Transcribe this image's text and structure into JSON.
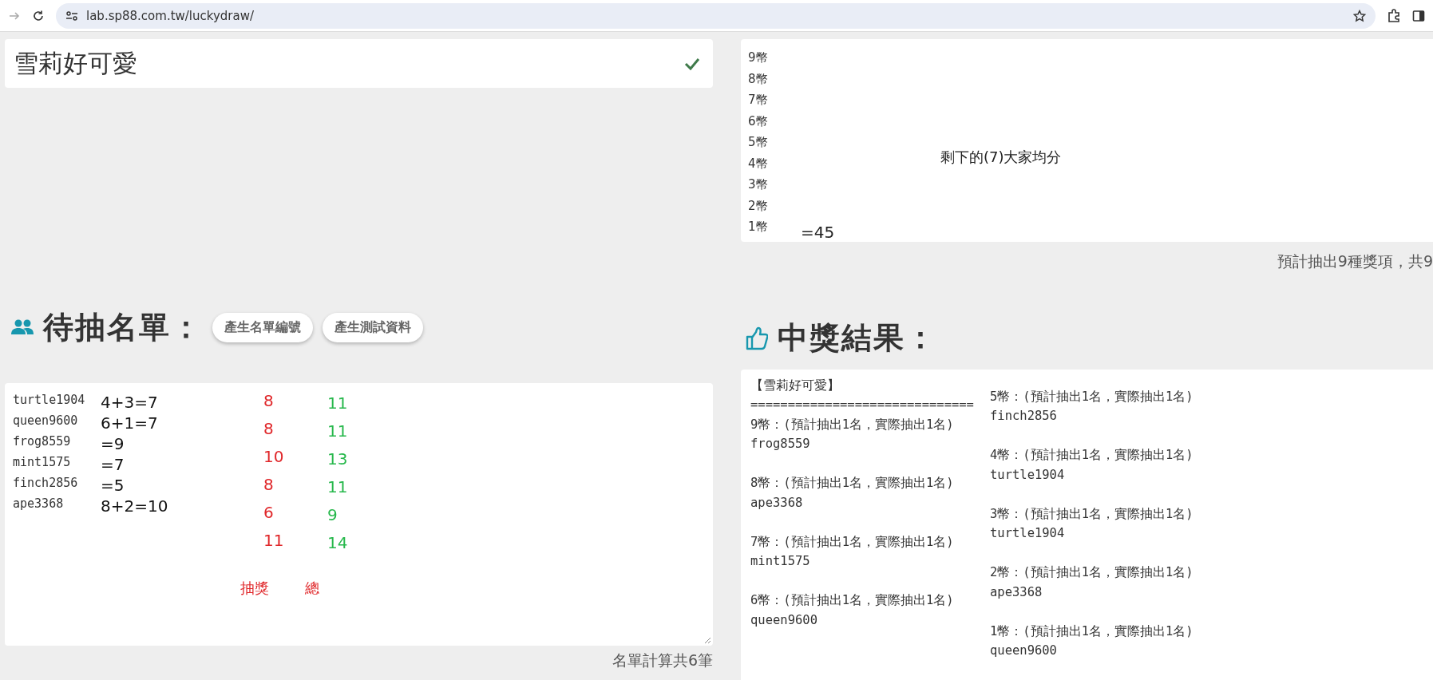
{
  "browser": {
    "url": "lab.sp88.com.tw/luckydraw/"
  },
  "title_card": {
    "title": "雪莉好可愛"
  },
  "prize_card": {
    "prizes": [
      "9幣",
      "8幣",
      "7幣",
      "6幣",
      "5幣",
      "4幣",
      "3幣",
      "2幣",
      "1幣"
    ],
    "note": "剩下的(7)大家均分",
    "sum": "=45"
  },
  "prize_summary": "預計抽出9種獎項，共9",
  "entrants": {
    "heading": "待抽名單：",
    "buttons": [
      "產生名單編號",
      "產生測試資料"
    ],
    "names": [
      "turtle1904",
      "queen9600",
      "frog8559",
      "mint1575",
      "finch2856",
      "ape3368"
    ],
    "formulas": [
      "4+3=7",
      "6+1=7",
      "=9",
      "=7",
      "=5",
      "8+2=10"
    ],
    "draw_counts": [
      "8",
      "8",
      "10",
      "8",
      "6",
      "11"
    ],
    "totals": [
      "11",
      "11",
      "13",
      "11",
      "9",
      "14"
    ],
    "draw_label": "抽獎",
    "total_label": "總",
    "footer": "名單計算共6筆"
  },
  "results": {
    "heading": "中獎結果：",
    "title": "【雪莉好可愛】",
    "separator": "==============================",
    "columns": [
      [
        {
          "prize": "9幣：(預計抽出1名，實際抽出1名)",
          "winner": "frog8559"
        },
        {
          "prize": "8幣：(預計抽出1名，實際抽出1名)",
          "winner": "ape3368"
        },
        {
          "prize": "7幣：(預計抽出1名，實際抽出1名)",
          "winner": "mint1575"
        },
        {
          "prize": "6幣：(預計抽出1名，實際抽出1名)",
          "winner": "queen9600"
        }
      ],
      [
        {
          "prize": "5幣：(預計抽出1名，實際抽出1名)",
          "winner": "finch2856"
        },
        {
          "prize": "4幣：(預計抽出1名，實際抽出1名)",
          "winner": "turtle1904"
        },
        {
          "prize": "3幣：(預計抽出1名，實際抽出1名)",
          "winner": "turtle1904"
        },
        {
          "prize": "2幣：(預計抽出1名，實際抽出1名)",
          "winner": "ape3368"
        },
        {
          "prize": "1幣：(預計抽出1名，實際抽出1名)",
          "winner": "queen9600"
        }
      ]
    ]
  }
}
